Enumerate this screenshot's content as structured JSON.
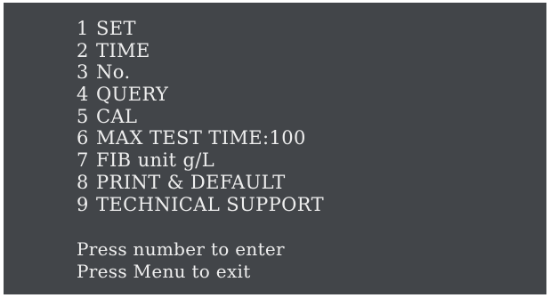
{
  "menu": {
    "items": [
      {
        "num": "1",
        "label": "SET"
      },
      {
        "num": "2",
        "label": "TIME"
      },
      {
        "num": "3",
        "label": "No."
      },
      {
        "num": "4",
        "label": "QUERY"
      },
      {
        "num": "5",
        "label": "CAL"
      },
      {
        "num": "6",
        "label": "MAX TEST TIME:100"
      },
      {
        "num": "7",
        "label": "FIB unit g/L"
      },
      {
        "num": "8",
        "label": "PRINT & DEFAULT"
      },
      {
        "num": "9",
        "label": "TECHNICAL SUPPORT"
      }
    ]
  },
  "hints": {
    "enter": "Press number to enter",
    "exit": "Press Menu to exit"
  },
  "colors": {
    "screen_background": "#424549",
    "text": "#eeeeee"
  }
}
